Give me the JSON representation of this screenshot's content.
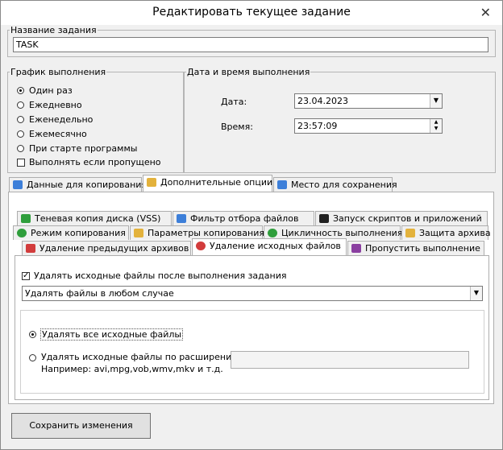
{
  "window": {
    "title": "Редактировать текущее задание",
    "close_glyph": "✕"
  },
  "task": {
    "legend": "Название задания",
    "value": "TASK"
  },
  "schedule": {
    "legend": "График выполнения",
    "options": [
      "Один раз",
      "Ежедневно",
      "Еженедельно",
      "Ежемесячно",
      "При старте программы"
    ],
    "selected": 0,
    "missed_label": "Выполнять если пропущено",
    "missed_checked": false
  },
  "datetime": {
    "legend": "Дата и время выполнения",
    "date_label": "Дата:",
    "date_value": "23.04.2023",
    "time_label": "Время:",
    "time_value": "23:57:09"
  },
  "main_tabs": [
    {
      "label": "Данные для копирования",
      "icon": "data-icon"
    },
    {
      "label": "Дополнительные опции",
      "icon": "options-icon",
      "active": true
    },
    {
      "label": "Место для сохранения",
      "icon": "save-location-icon"
    }
  ],
  "sub_tabs": {
    "row1": [
      {
        "label": "Теневая копия диска (VSS)",
        "icon": "shadow-copy-icon"
      },
      {
        "label": "Фильтр отбора файлов",
        "icon": "filter-icon"
      },
      {
        "label": "Запуск скриптов и приложений",
        "icon": "terminal-icon"
      }
    ],
    "row2": [
      {
        "label": "Режим копирования",
        "icon": "copy-mode-icon"
      },
      {
        "label": "Параметры копирования",
        "icon": "copy-params-icon"
      },
      {
        "label": "Цикличность выполнения",
        "icon": "cycle-icon"
      },
      {
        "label": "Защита архива",
        "icon": "lock-icon"
      }
    ],
    "row3": [
      {
        "label": "Удаление предыдущих архивов",
        "icon": "delete-archives-icon"
      },
      {
        "label": "Удаление исходных файлов",
        "icon": "delete-source-icon",
        "active": true
      },
      {
        "label": "Пропустить выполнение",
        "icon": "skip-icon"
      }
    ]
  },
  "delete_panel": {
    "enable_label": "Удалять исходные файлы после выполнения задания",
    "enable_checked": true,
    "mode_value": "Удалять файлы в любом случае",
    "option_all": "Удалять все исходные файлы",
    "option_ext": "Удалять исходные файлы по расширению",
    "option_ext_hint": "Например: avi,mpg,vob,wmv,mkv и т.д.",
    "ext_value": "",
    "selected": 0
  },
  "save_button": "Сохранить изменения",
  "colors": {
    "icon_blue": "#3d7fd9",
    "icon_green": "#2f9e3c",
    "icon_red": "#d23c3c",
    "icon_gold": "#e3b23c",
    "icon_purple": "#8a3fa0",
    "dark": "#222222"
  }
}
